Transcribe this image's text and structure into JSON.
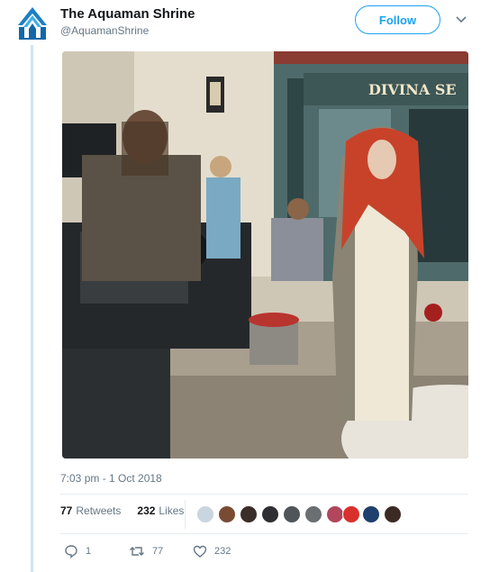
{
  "tweet": {
    "author_name": "The Aquaman Shrine",
    "author_handle": "@AquamanShrine",
    "follow_label": "Follow",
    "timestamp": "7:03 pm - 1 Oct 2018",
    "photo_storefront_sign": "DIVINA SE"
  },
  "stats": {
    "retweets_count": "77",
    "retweets_label": "Retweets",
    "likes_count": "232",
    "likes_label": "Likes"
  },
  "actions": {
    "reply_count": "1",
    "retweet_count": "77",
    "like_count": "232"
  },
  "colors": {
    "accent": "#1da1f2",
    "muted_text": "#657786",
    "thread_line": "#cfe3f5"
  },
  "icons": [
    "aquaman-logo-icon",
    "chevron-down-icon",
    "reply-icon",
    "retweet-icon",
    "heart-icon"
  ]
}
